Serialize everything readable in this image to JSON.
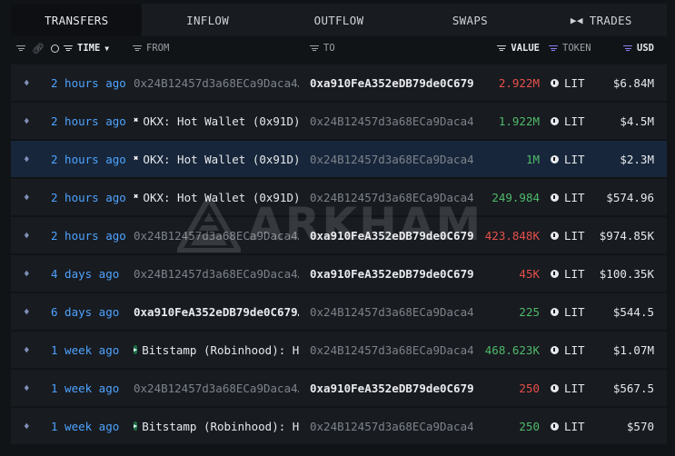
{
  "tabs": [
    {
      "label": "TRANSFERS",
      "active": true
    },
    {
      "label": "INFLOW",
      "active": false
    },
    {
      "label": "OUTFLOW",
      "active": false
    },
    {
      "label": "SWAPS",
      "active": false
    },
    {
      "label": "TRADES",
      "active": false
    }
  ],
  "headers": {
    "time": "TIME",
    "from": "FROM",
    "to": "TO",
    "value": "VALUE",
    "token": "TOKEN",
    "usd": "USD"
  },
  "watermark": "ARKHAM",
  "colors": {
    "time_link": "#4ea3ff",
    "value_out": "#e6504a",
    "value_in": "#4fba6a",
    "filter_accent": "#8b7cf0",
    "highlight_row": "#17263a"
  },
  "rows": [
    {
      "time": "2 hours ago",
      "from": "0x24B12457d3a68ECa9Daca4…",
      "from_kind": "address",
      "to": "0xa910FeA352eDB79de0C679…",
      "to_bright": true,
      "value": "2.922M",
      "value_color": "red",
      "token": "LIT",
      "usd": "$6.84M"
    },
    {
      "time": "2 hours ago",
      "from": "OKX: Hot Wallet (0x91D)",
      "from_kind": "okx",
      "to": "0x24B12457d3a68ECa9Daca4…",
      "to_bright": false,
      "value": "1.922M",
      "value_color": "green",
      "token": "LIT",
      "usd": "$4.5M"
    },
    {
      "time": "2 hours ago",
      "from": "OKX: Hot Wallet (0x91D)",
      "from_kind": "okx",
      "to": "0x24B12457d3a68ECa9Daca4…",
      "to_bright": false,
      "value": "1M",
      "value_color": "green",
      "token": "LIT",
      "usd": "$2.3M",
      "highlighted": true
    },
    {
      "time": "2 hours ago",
      "from": "OKX: Hot Wallet (0x91D)",
      "from_kind": "okx",
      "to": "0x24B12457d3a68ECa9Daca4…",
      "to_bright": false,
      "value": "249.984",
      "value_color": "green",
      "token": "LIT",
      "usd": "$574.96"
    },
    {
      "time": "2 hours ago",
      "from": "0x24B12457d3a68ECa9Daca4…",
      "from_kind": "address",
      "to": "0xa910FeA352eDB79de0C679…",
      "to_bright": true,
      "value": "423.848K",
      "value_color": "red",
      "token": "LIT",
      "usd": "$974.85K"
    },
    {
      "time": "4 days ago",
      "from": "0x24B12457d3a68ECa9Daca4…",
      "from_kind": "address",
      "to": "0xa910FeA352eDB79de0C679…",
      "to_bright": true,
      "value": "45K",
      "value_color": "red",
      "token": "LIT",
      "usd": "$100.35K"
    },
    {
      "time": "6 days ago",
      "from": "0xa910FeA352eDB79de0C679…",
      "from_kind": "address_bright",
      "to": "0x24B12457d3a68ECa9Daca4…",
      "to_bright": false,
      "value": "225",
      "value_color": "green",
      "token": "LIT",
      "usd": "$544.5"
    },
    {
      "time": "1 week ago",
      "from": "Bitstamp (Robinhood): H",
      "from_kind": "bitstamp",
      "to": "0x24B12457d3a68ECa9Daca4…",
      "to_bright": false,
      "value": "468.623K",
      "value_color": "green",
      "token": "LIT",
      "usd": "$1.07M"
    },
    {
      "time": "1 week ago",
      "from": "0x24B12457d3a68ECa9Daca4…",
      "from_kind": "address",
      "to": "0xa910FeA352eDB79de0C679…",
      "to_bright": true,
      "value": "250",
      "value_color": "red",
      "token": "LIT",
      "usd": "$567.5"
    },
    {
      "time": "1 week ago",
      "from": "Bitstamp (Robinhood): H",
      "from_kind": "bitstamp",
      "to": "0x24B12457d3a68ECa9Daca4…",
      "to_bright": false,
      "value": "250",
      "value_color": "green",
      "token": "LIT",
      "usd": "$570"
    }
  ]
}
